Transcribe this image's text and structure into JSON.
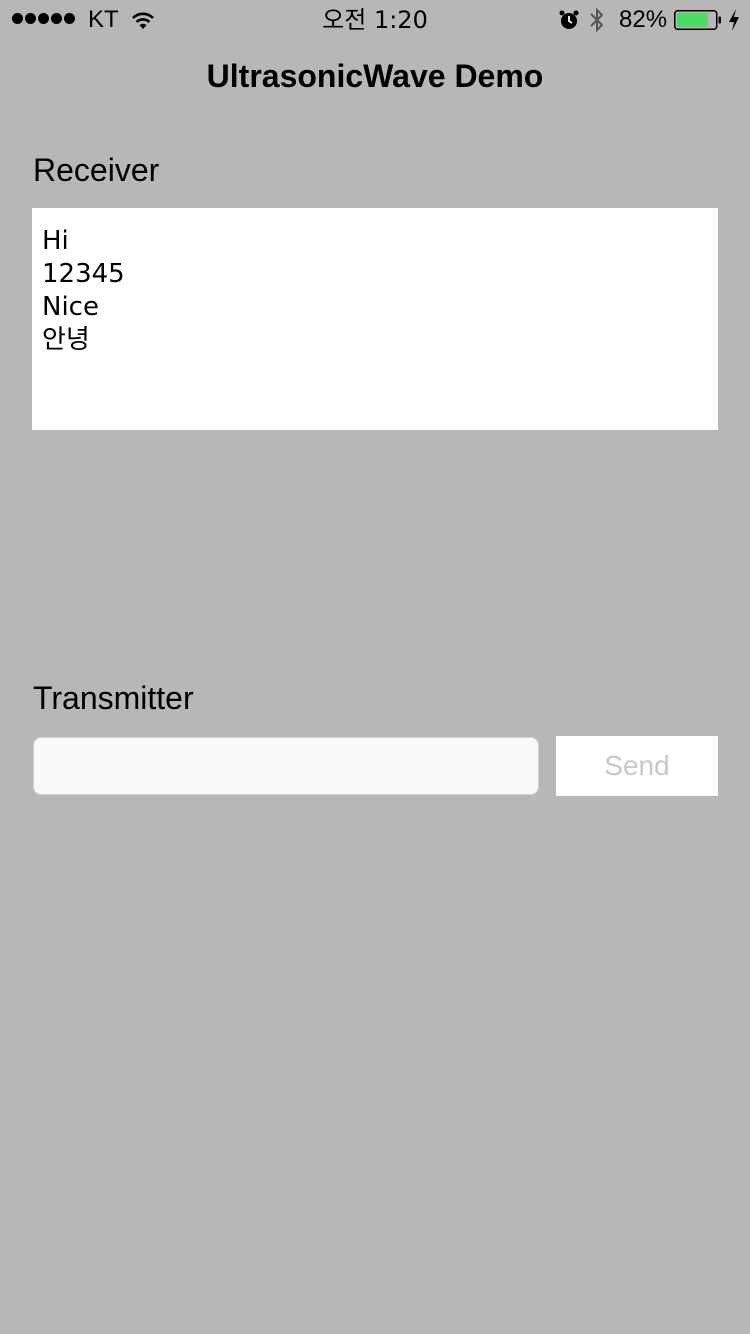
{
  "status_bar": {
    "carrier": "KT",
    "time": "오전 1:20",
    "battery_percent_label": "82%",
    "battery_level": 0.82,
    "battery_color": "#4cd964",
    "icons": [
      "signal-dots-icon",
      "wifi-icon",
      "alarm-icon",
      "bluetooth-icon",
      "battery-icon",
      "charging-icon"
    ]
  },
  "nav": {
    "title": "UltrasonicWave Demo"
  },
  "receiver": {
    "label": "Receiver",
    "lines": [
      "Hi",
      "12345",
      "Nice",
      "안녕"
    ]
  },
  "transmitter": {
    "label": "Transmitter",
    "input_value": "",
    "input_placeholder": "",
    "send_label": "Send"
  },
  "colors": {
    "background": "#b7b7b7",
    "send_text_disabled": "#c8c8c8"
  }
}
